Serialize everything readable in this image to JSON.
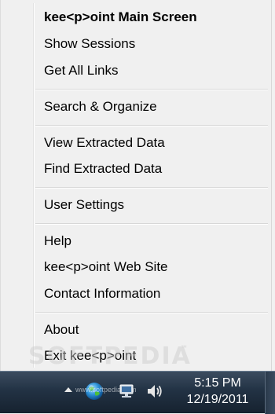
{
  "menu": {
    "items": [
      {
        "label": "kee<p>oint Main Screen",
        "bold": true
      },
      {
        "label": "Show Sessions"
      },
      {
        "label": "Get All Links"
      },
      {
        "label": "Search & Organize"
      },
      {
        "label": "View Extracted Data"
      },
      {
        "label": "Find Extracted Data"
      },
      {
        "label": "User Settings"
      },
      {
        "label": "Help"
      },
      {
        "label": "kee<p>oint Web Site"
      },
      {
        "label": "Contact Information"
      },
      {
        "label": "About"
      },
      {
        "label": "Exit kee<p>oint"
      }
    ]
  },
  "watermark": {
    "text": "SOFTPEDIA",
    "tm": "™"
  },
  "taskbar": {
    "tray_watermark": "www.softpedia.com",
    "clock": {
      "time": "5:15 PM",
      "date": "12/19/2011"
    },
    "icons": [
      "show-hidden-icons-arrow",
      "globe-icon",
      "network-icon",
      "volume-icon"
    ]
  },
  "colors": {
    "menu_bg": "#f0f0f0",
    "taskbar_top": "#3b4c5f",
    "taskbar_bottom": "#16222f",
    "text": "#000000"
  }
}
